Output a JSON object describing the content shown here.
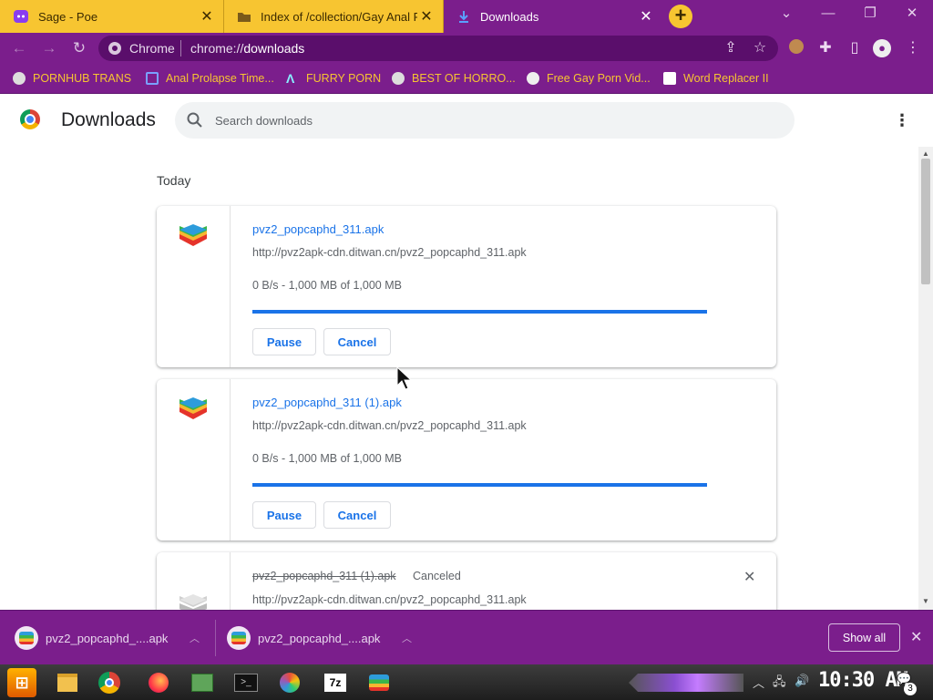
{
  "tabs": [
    {
      "title": "Sage - Poe",
      "icon": "poe-icon"
    },
    {
      "title": "Index of /collection/Gay Anal P",
      "icon": "folder-icon"
    },
    {
      "title": "Downloads",
      "icon": "download-icon"
    }
  ],
  "omnibox": {
    "site_chip": "Chrome",
    "url_prefix": "chrome://",
    "url_host": "downloads"
  },
  "bookmarks": [
    {
      "label": "PORNHUB TRANS",
      "icon": "globe-icon"
    },
    {
      "label": "Anal Prolapse Time...",
      "icon": "bracket-icon"
    },
    {
      "label": "FURRY PORN",
      "icon": "lambda-icon"
    },
    {
      "label": "BEST OF HORRO...",
      "icon": "globe-icon"
    },
    {
      "label": "Free Gay Porn Vid...",
      "icon": "skull-icon"
    },
    {
      "label": "Word Replacer II",
      "icon": "wr-icon"
    }
  ],
  "page": {
    "title": "Downloads",
    "search_placeholder": "Search downloads",
    "section": "Today"
  },
  "downloads": [
    {
      "filename": "pvz2_popcaphd_311.apk",
      "url": "http://pvz2apk-cdn.ditwan.cn/pvz2_popcaphd_311.apk",
      "status": "0 B/s - 1,000 MB of 1,000 MB",
      "progress": 1.0,
      "pause_label": "Pause",
      "cancel_label": "Cancel"
    },
    {
      "filename": "pvz2_popcaphd_311 (1).apk",
      "url": "http://pvz2apk-cdn.ditwan.cn/pvz2_popcaphd_311.apk",
      "status": "0 B/s - 1,000 MB of 1,000 MB",
      "progress": 1.0,
      "pause_label": "Pause",
      "cancel_label": "Cancel"
    },
    {
      "filename": "pvz2_popcaphd_311 (1).apk",
      "state": "Canceled",
      "url": "http://pvz2apk-cdn.ditwan.cn/pvz2_popcaphd_311.apk"
    }
  ],
  "shelf": {
    "items": [
      "pvz2_popcaphd_....apk",
      "pvz2_popcaphd_....apk"
    ],
    "show_all_label": "Show all"
  },
  "taskbar": {
    "clock": "10:30 AM",
    "notification_count": "3"
  },
  "colors": {
    "theme_purple": "#7b1e8c",
    "tab_yellow": "#f7c531",
    "link_blue": "#1a73e8"
  }
}
